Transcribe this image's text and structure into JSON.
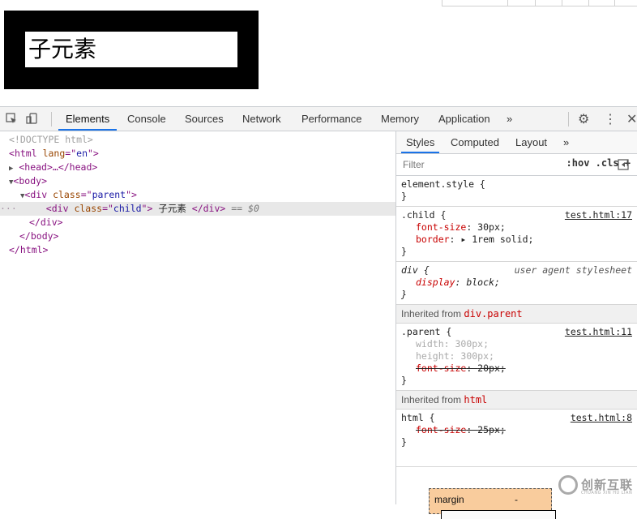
{
  "preview": {
    "child_text": "子元素"
  },
  "toolbar": {
    "tabs": [
      "Elements",
      "Console",
      "Sources",
      "Network",
      "Performance",
      "Memory",
      "Application"
    ],
    "more": "»",
    "gear": "⚙",
    "kebab": "⋮",
    "close": "✕"
  },
  "elements": {
    "doctype": "<!DOCTYPE html>",
    "html_tag": "html",
    "html_attr": "lang",
    "html_attr_val": "en",
    "head_text": "<head>…</head>",
    "body_tag": "body",
    "div_tag": "div",
    "parent_attr": "class",
    "parent_val": "parent",
    "child_val": "child",
    "child_text": " 子元素 ",
    "selected_suffix": "== $0",
    "div_close": "</div>",
    "body_close": "</body>",
    "html_close": "</html>"
  },
  "styles": {
    "subtabs": [
      "Styles",
      "Computed",
      "Layout",
      "»"
    ],
    "filter_placeholder": "Filter",
    "filter_tools": ":hov  .cls  +",
    "element_style": "element.style {",
    "close_brace": "}",
    "child_selector": ".child {",
    "child_source": "test.html:17",
    "child_props": [
      {
        "name": "font-size",
        "value": "30px;"
      },
      {
        "name": "border",
        "value": "▸ 1rem solid;"
      }
    ],
    "div_selector": "div {",
    "ua_label": "user agent stylesheet",
    "div_prop": {
      "name": "display",
      "value": "block;"
    },
    "inherited_prefix": "Inherited from ",
    "inherited_parent": "div.parent",
    "parent_selector": ".parent {",
    "parent_source": "test.html:11",
    "parent_props": [
      {
        "name": "width",
        "value": "300px;"
      },
      {
        "name": "height",
        "value": "300px;"
      },
      {
        "name": "font-size",
        "value": "20px;"
      }
    ],
    "inherited_html": "html",
    "html_selector": "html {",
    "html_source": "test.html:8",
    "html_prop": {
      "name": "font-size",
      "value": "25px;"
    },
    "boxmodel_label": "margin",
    "boxmodel_dash": "-"
  },
  "watermark": {
    "text": "创新互联",
    "sub": "CHUANG XIN HU LIAN"
  }
}
